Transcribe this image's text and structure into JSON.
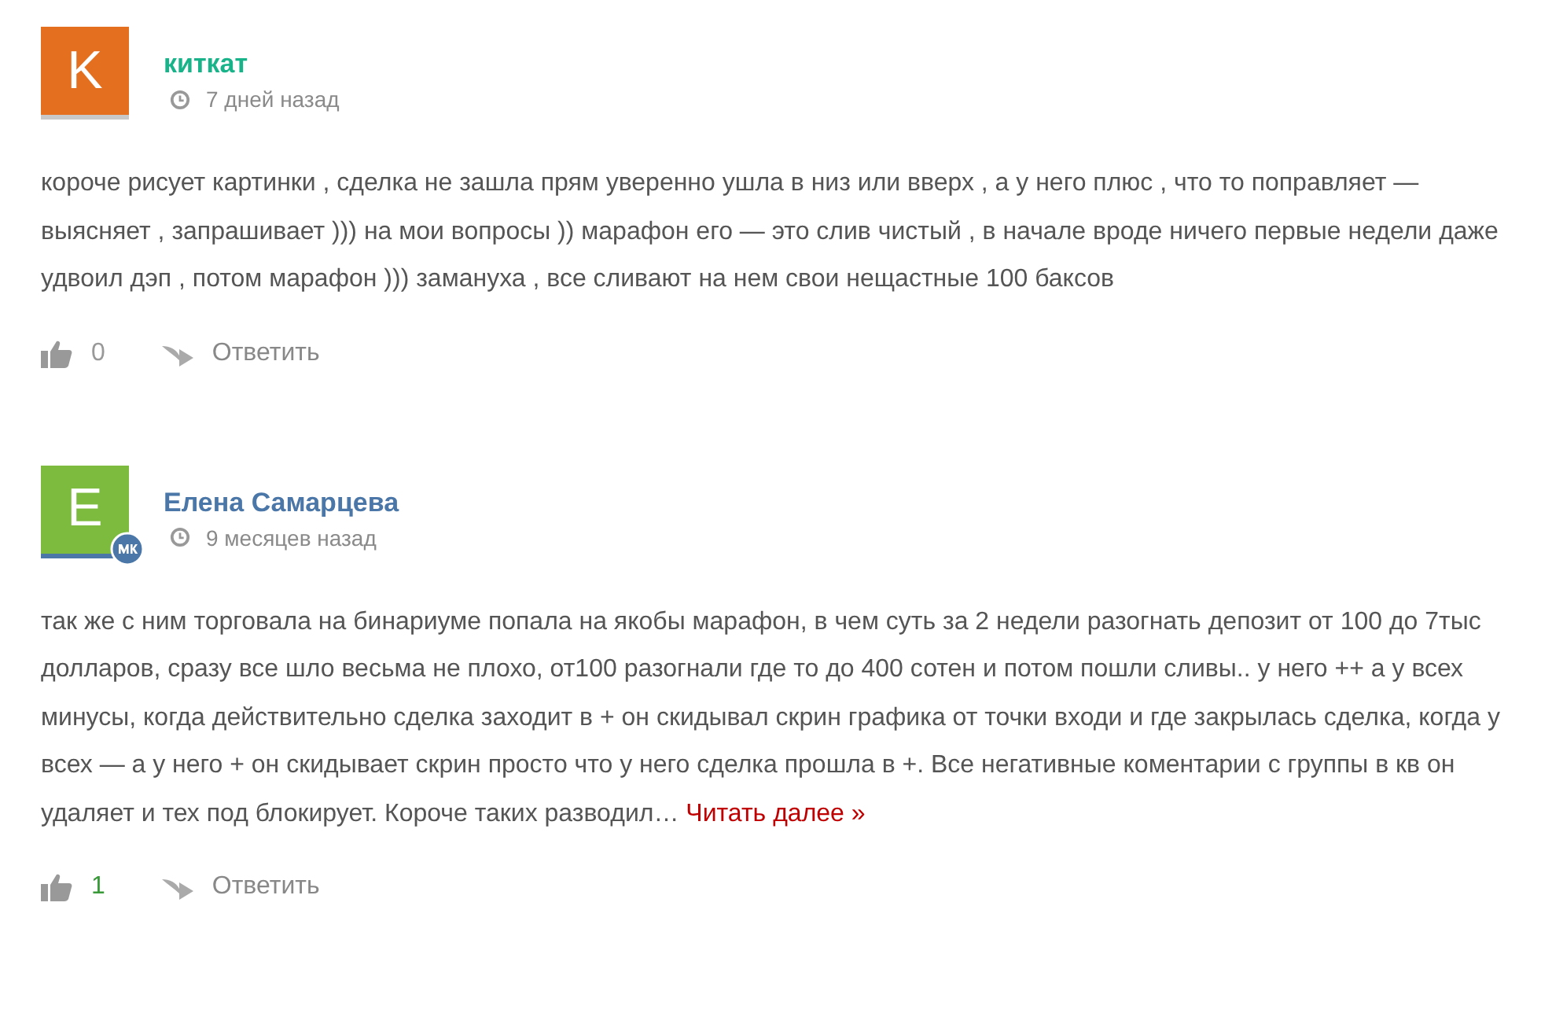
{
  "comments": [
    {
      "kind": "guest",
      "avatar_letter": "K",
      "color": "#e46f1e",
      "author": "киткат",
      "time": "7 дней назад",
      "text": "короче рисует картинки , сделка не зашла прям уверенно ушла в низ или вверх , а у него плюс , что то поправляет — выясняет , запрашивает ))) на мои вопросы )) марафон его — это слив чистый , в начале вроде ничего первые недели даже удвоил дэп , потом марафон ))) замануха , все сливают на нем свои нещастные 100 баксов",
      "likes": "0",
      "liked": false,
      "reply": "Ответить"
    },
    {
      "kind": "vk",
      "avatar_letter": "E",
      "color": "#7cbb3d",
      "author": "Елена Самарцева",
      "time": "9 месяцев назад",
      "text": "так же с ним торговала на бинариуме попала на якобы марафон, в чем суть за 2 недели разогнать депозит от 100 до 7тыс долларов, сразу все шло весьма не плохо, от100 разогнали где то до 400 сотен и потом пошли сливы.. у него ++ а у всех минусы, когда действительно сделка заходит в + он скидывал скрин графика от точки входи и где закрылась сделка, когда у всех — а у него + он скидывает скрин просто что у него сделка прошла в +. Все негативные коментарии с группы в кв он удаляет и тех под блокирует. Короче таких разводил…",
      "read_more": "Читать далее »",
      "likes": "1",
      "liked": true,
      "reply": "Ответить"
    }
  ]
}
